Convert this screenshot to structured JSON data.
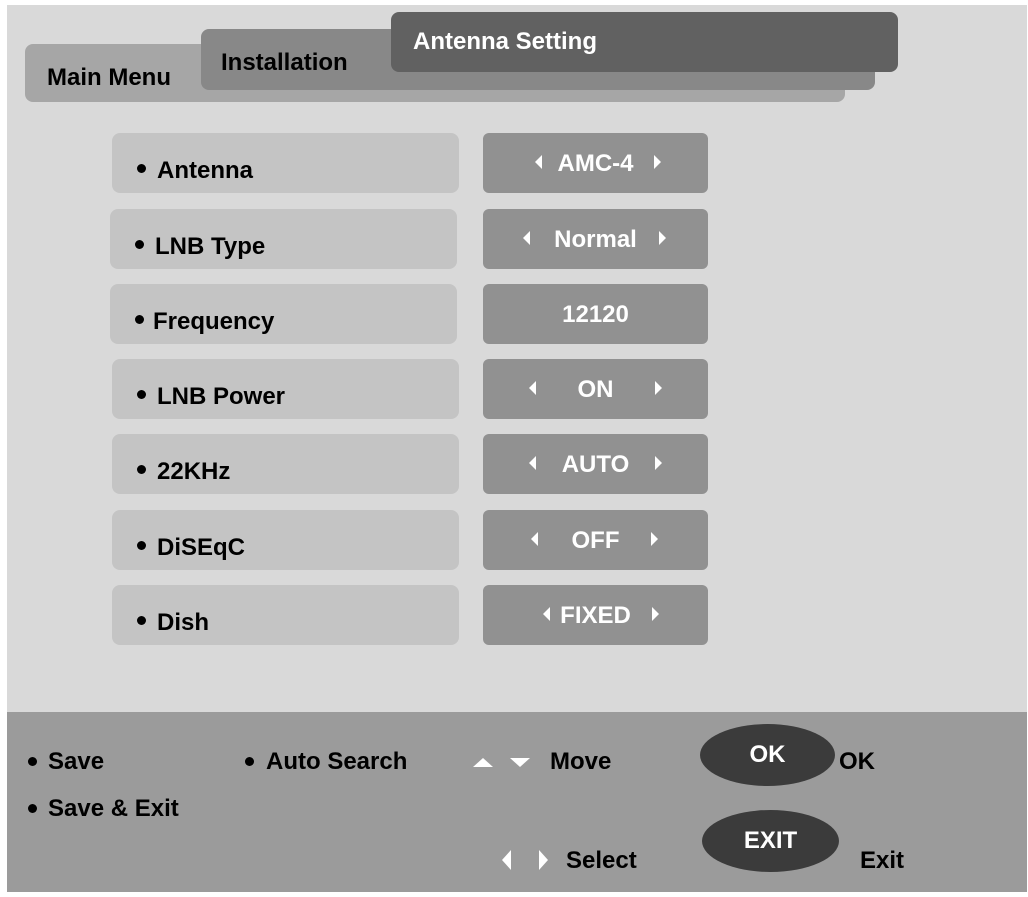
{
  "tabs": {
    "main_menu": "Main Menu",
    "installation": "Installation",
    "antenna_setting": "Antenna Setting"
  },
  "settings": [
    {
      "label": "Antenna",
      "value": "AMC-4",
      "arrows": true
    },
    {
      "label": "LNB Type",
      "value": "Normal",
      "arrows": true
    },
    {
      "label": "Frequency",
      "value": "12120",
      "arrows": false
    },
    {
      "label": "LNB Power",
      "value": "ON",
      "arrows": true
    },
    {
      "label": "22KHz",
      "value": "AUTO",
      "arrows": true
    },
    {
      "label": "DiSEqC",
      "value": "OFF",
      "arrows": true
    },
    {
      "label": "Dish",
      "value": "FIXED",
      "arrows": true
    }
  ],
  "hints": {
    "save": "Save",
    "auto_search": "Auto Search",
    "move": "Move",
    "ok_button": "OK",
    "ok_text": "OK",
    "save_exit": "Save & Exit",
    "select": "Select",
    "exit_button": "EXIT",
    "exit_text": "Exit"
  },
  "colors": {
    "screen_bg": "#d9d9d9",
    "label_bg": "#c4c4c4",
    "value_bg": "#919191",
    "bottom_bar": "#9b9b9b",
    "active_tab": "#616161",
    "pill": "#3b3b3b"
  },
  "icons": [
    "bullet-dot-icon",
    "arrow-left-icon",
    "arrow-right-icon",
    "arrow-up-icon",
    "arrow-down-icon"
  ]
}
